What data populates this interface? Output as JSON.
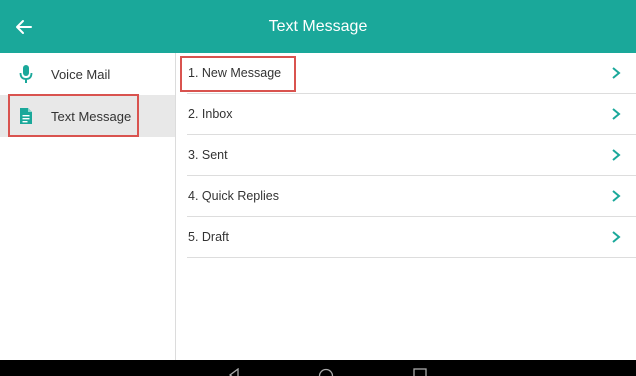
{
  "header": {
    "title": "Text Message",
    "back_icon": "arrow-left-icon",
    "background_color": "#1aa89a"
  },
  "sidebar": {
    "items": [
      {
        "label": "Voice Mail",
        "icon": "microphone-icon",
        "active": false
      },
      {
        "label": "Text Message",
        "icon": "document-icon",
        "active": true
      }
    ]
  },
  "menu": {
    "items": [
      {
        "label": "1. New Message",
        "icon": "chevron-right-icon"
      },
      {
        "label": "2. Inbox",
        "icon": "chevron-right-icon"
      },
      {
        "label": "3. Sent",
        "icon": "chevron-right-icon"
      },
      {
        "label": "4. Quick Replies",
        "icon": "chevron-right-icon"
      },
      {
        "label": "5. Draft",
        "icon": "chevron-right-icon"
      }
    ]
  },
  "navbar": {
    "buttons": [
      "back-triangle-icon",
      "home-circle-icon",
      "recents-square-icon"
    ]
  },
  "colors": {
    "accent": "#1aa89a",
    "highlight": "#d9534f"
  }
}
